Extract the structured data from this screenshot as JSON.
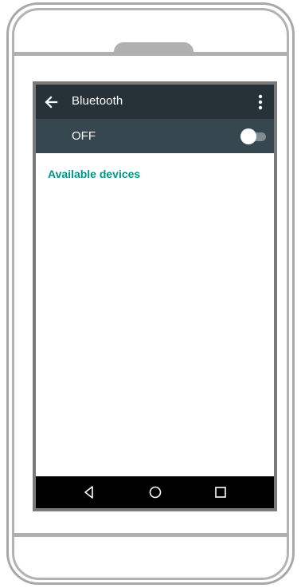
{
  "app_bar": {
    "title": "Bluetooth",
    "back_icon": "arrow-left-icon",
    "overflow_icon": "more-vert-icon"
  },
  "switch_bar": {
    "label": "OFF",
    "state": "off"
  },
  "content": {
    "section_header": "Available devices"
  },
  "nav_bar": {
    "back_icon": "triangle-back-icon",
    "home_icon": "circle-home-icon",
    "recents_icon": "square-recents-icon"
  },
  "colors": {
    "app_bar": "#263238",
    "switch_bar": "#37474f",
    "accent": "#009688",
    "nav_bar": "#000000"
  }
}
